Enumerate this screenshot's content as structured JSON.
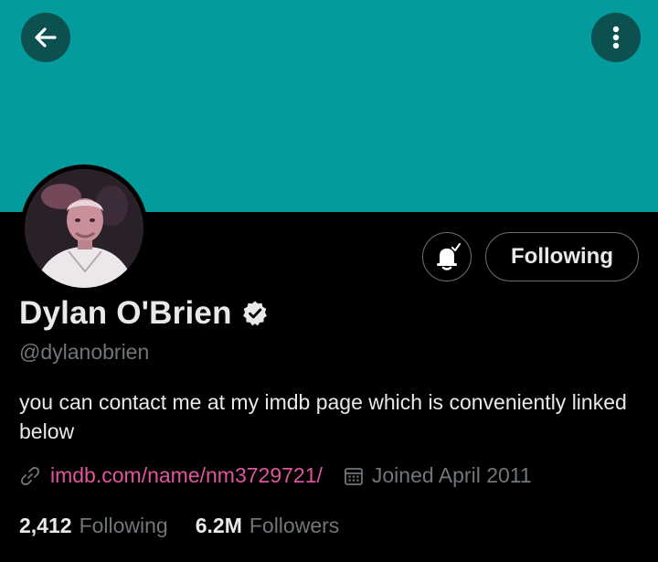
{
  "header": {
    "back_icon": "arrow-left-icon",
    "more_icon": "vertical-ellipsis-icon",
    "banner_color": "#039b9b"
  },
  "profile": {
    "display_name": "Dylan O'Brien",
    "verified_icon": "verified-badge-icon",
    "handle": "@dylanobrien",
    "bio": "you can contact me at my imdb page which is conveniently linked below",
    "link_icon": "link-icon",
    "link": "imdb.com/name/nm3729721/",
    "calendar_icon": "calendar-icon",
    "joined": "Joined April 2011"
  },
  "actions": {
    "notifications_icon": "bell-check-icon",
    "following_label": "Following"
  },
  "stats": {
    "following_count": "2,412",
    "following_label": "Following",
    "followers_count": "6.2M",
    "followers_label": "Followers"
  },
  "colors": {
    "accent_link": "#e0559e",
    "muted_text": "#71767b",
    "primary_text": "#e7e9ea"
  }
}
